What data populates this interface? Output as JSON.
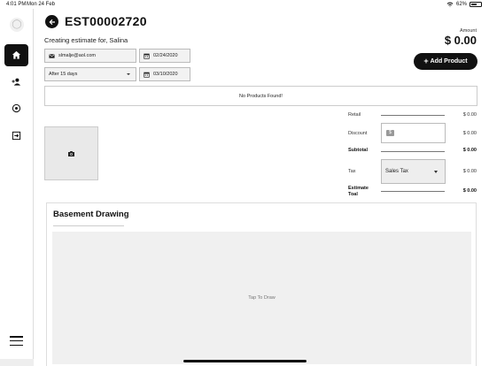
{
  "status_bar": {
    "time": "4:01 PM",
    "date": "Mon 24 Feb",
    "battery": "62%",
    "wifi_icon": "wifi-icon"
  },
  "sidebar": {
    "items": [
      {
        "icon": "home-icon",
        "active": true
      },
      {
        "icon": "add-user-icon",
        "active": false
      },
      {
        "icon": "history-icon",
        "active": false
      },
      {
        "icon": "export-icon",
        "active": false
      }
    ],
    "menu_icon": "hamburger-menu-icon"
  },
  "header": {
    "title": "EST00002720",
    "subtitle": "Creating estimate for, Salina",
    "amount_label": "Amount",
    "amount_value": "$ 0.00",
    "add_product_label": "Add Product"
  },
  "form": {
    "email": "slmalje@aol.com",
    "date": "02/24/2020",
    "terms": "After 15 days",
    "due_date": "03/10/2020"
  },
  "products": {
    "empty_message": "No Products Found!"
  },
  "summary": {
    "retail_label": "Retail",
    "retail_value": "$ 0.00",
    "discount_label": "Discount",
    "discount_value": "$ 0.00",
    "subtotal_label": "Subtotal",
    "subtotal_value": "$ 0.00",
    "tax_label": "Tax",
    "tax_select": "Sales Tax",
    "tax_value": "$ 0.00",
    "total_label_line1": "Estimate",
    "total_label_line2": "Toal",
    "total_value": "$ 0.00"
  },
  "drawing": {
    "title": "Basement Drawing",
    "placeholder": "Tap To Draw"
  }
}
